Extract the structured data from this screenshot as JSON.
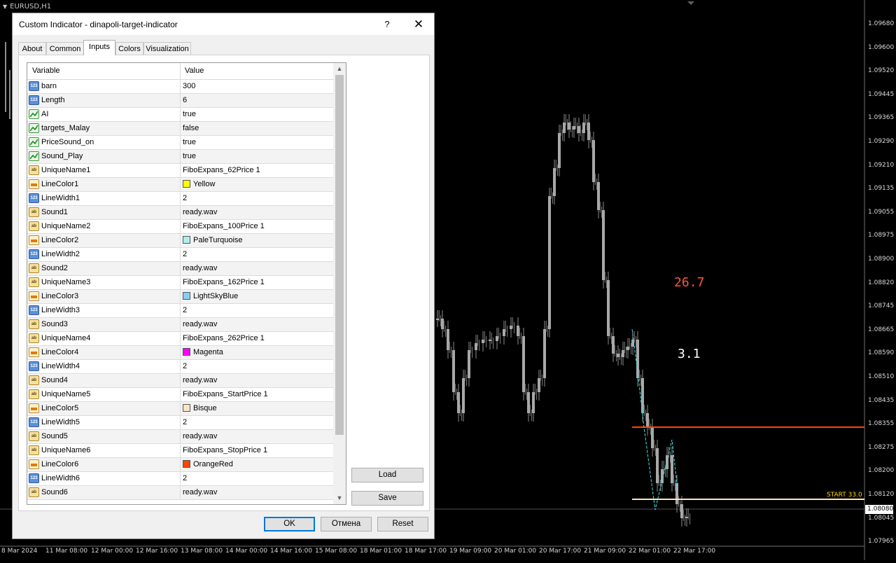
{
  "chart": {
    "symbol": "EURUSD,H1",
    "price_axis": [
      "1.09680",
      "1.09600",
      "1.09520",
      "1.09445",
      "1.09365",
      "1.09290",
      "1.09210",
      "1.09135",
      "1.09055",
      "1.08975",
      "1.08900",
      "1.08820",
      "1.08745",
      "1.08665",
      "1.08590",
      "1.08510",
      "1.08435",
      "1.08355",
      "1.08275",
      "1.08200",
      "1.08120",
      "1.08045",
      "1.07965"
    ],
    "current_price": "1.08080",
    "time_axis": [
      "8 Mar 2024",
      "11 Mar 08:00",
      "12 Mar 00:00",
      "12 Mar 16:00",
      "13 Mar 08:00",
      "14 Mar 00:00",
      "14 Mar 16:00",
      "15 Mar 08:00",
      "18 Mar 01:00",
      "18 Mar 17:00",
      "19 Mar 09:00",
      "20 Mar 01:00",
      "20 Mar 17:00",
      "21 Mar 09:00",
      "22 Mar 01:00",
      "22 Mar 17:00"
    ],
    "label_a": "26.7",
    "label_b": "3.1",
    "start_label": "START 33.0",
    "colors": {
      "label_a": "#ff5a32",
      "label_b": "#ffffff",
      "orange_line": "#ff4500",
      "start_line": "#ffe4b5",
      "zigzag": "#40e0e8"
    }
  },
  "dialog": {
    "title": "Custom Indicator - dinapoli-target-indicator",
    "help": "?",
    "close": "✕",
    "tabs": [
      "About",
      "Common",
      "Inputs",
      "Colors",
      "Visualization"
    ],
    "active_tab": "Inputs",
    "columns": {
      "variable": "Variable",
      "value": "Value"
    },
    "rows": [
      {
        "type": "int",
        "name": "barn",
        "value": "300"
      },
      {
        "type": "int",
        "name": "Length",
        "value": "6"
      },
      {
        "type": "bool",
        "name": "AI",
        "value": "true"
      },
      {
        "type": "bool",
        "name": "targets_Malay",
        "value": "false"
      },
      {
        "type": "bool",
        "name": "PriceSound_on",
        "value": "true"
      },
      {
        "type": "bool",
        "name": "Sound_Play",
        "value": "true"
      },
      {
        "type": "str",
        "name": "UniqueName1",
        "value": "FiboExpans_62Price 1"
      },
      {
        "type": "color",
        "name": "LineColor1",
        "value": "Yellow",
        "swatch": "#ffff00"
      },
      {
        "type": "int",
        "name": "LineWidth1",
        "value": "2"
      },
      {
        "type": "str",
        "name": "Sound1",
        "value": "ready.wav"
      },
      {
        "type": "str",
        "name": "UniqueName2",
        "value": "FiboExpans_100Price 1"
      },
      {
        "type": "color",
        "name": "LineColor2",
        "value": "PaleTurquoise",
        "swatch": "#afeeee"
      },
      {
        "type": "int",
        "name": "LineWidth2",
        "value": "2"
      },
      {
        "type": "str",
        "name": "Sound2",
        "value": "ready.wav"
      },
      {
        "type": "str",
        "name": "UniqueName3",
        "value": "FiboExpans_162Price 1"
      },
      {
        "type": "color",
        "name": "LineColor3",
        "value": "LightSkyBlue",
        "swatch": "#87cefa"
      },
      {
        "type": "int",
        "name": "LineWidth3",
        "value": "2"
      },
      {
        "type": "str",
        "name": "Sound3",
        "value": "ready.wav"
      },
      {
        "type": "str",
        "name": "UniqueName4",
        "value": "FiboExpans_262Price 1"
      },
      {
        "type": "color",
        "name": "LineColor4",
        "value": "Magenta",
        "swatch": "#ff00ff"
      },
      {
        "type": "int",
        "name": "LineWidth4",
        "value": "2"
      },
      {
        "type": "str",
        "name": "Sound4",
        "value": "ready.wav"
      },
      {
        "type": "str",
        "name": "UniqueName5",
        "value": "FiboExpans_StartPrice 1"
      },
      {
        "type": "color",
        "name": "LineColor5",
        "value": "Bisque",
        "swatch": "#ffe4c4"
      },
      {
        "type": "int",
        "name": "LineWidth5",
        "value": "2"
      },
      {
        "type": "str",
        "name": "Sound5",
        "value": "ready.wav"
      },
      {
        "type": "str",
        "name": "UniqueName6",
        "value": "FiboExpans_StopPrice 1"
      },
      {
        "type": "color",
        "name": "LineColor6",
        "value": "OrangeRed",
        "swatch": "#ff4500"
      },
      {
        "type": "int",
        "name": "LineWidth6",
        "value": "2"
      },
      {
        "type": "str",
        "name": "Sound6",
        "value": "ready.wav"
      }
    ],
    "buttons": {
      "load": "Load",
      "save": "Save",
      "ok": "OK",
      "cancel": "Отмена",
      "reset": "Reset"
    }
  }
}
